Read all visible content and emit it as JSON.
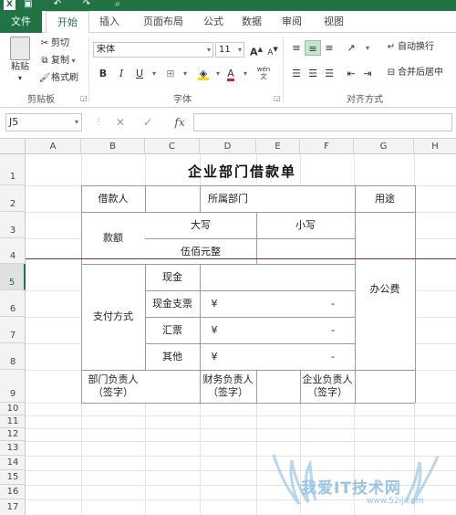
{
  "ribbon_tabs": [
    "文件",
    "开始",
    "插入",
    "页面布局",
    "公式",
    "数据",
    "审阅",
    "视图"
  ],
  "clipboard": {
    "paste": "粘贴",
    "cut": "剪切",
    "copy": "复制",
    "format_painter": "格式刷",
    "group_label": "剪贴板"
  },
  "font": {
    "name": "宋体",
    "size": "11",
    "grow": "A",
    "shrink": "A",
    "bold": "B",
    "italic": "I",
    "underline": "U",
    "wen": "wén",
    "group_label": "字体"
  },
  "alignment": {
    "wrap_text": "自动换行",
    "merge_center": "合并后居中",
    "group_label": "对齐方式"
  },
  "formula_bar": {
    "cell_ref": "J5",
    "fx": "fx",
    "value": ""
  },
  "columns": [
    "A",
    "B",
    "C",
    "D",
    "E",
    "F",
    "G",
    "H"
  ],
  "rows": [
    "1",
    "2",
    "3",
    "4",
    "5",
    "6",
    "7",
    "8",
    "9",
    "10",
    "11",
    "12",
    "13",
    "14",
    "15",
    "16",
    "17"
  ],
  "form": {
    "title": "企业部门借款单",
    "borrower": "借款人",
    "department": "所属部门",
    "purpose": "用途",
    "amount": "款额",
    "uppercase": "大写",
    "lowercase": "小写",
    "amount_upper": "伍佰元整",
    "purpose_value": "办公费",
    "payment_method": "支付方式",
    "cash": "现金",
    "cash_check": "现金支票",
    "draft": "汇票",
    "other": "其他",
    "yen": "¥",
    "dash": "-",
    "dept_head": "部门负责人",
    "finance_head": "财务负责人",
    "company_head": "企业负责人",
    "sign": "（签字）"
  },
  "watermark": {
    "text": "我爱IT技术网",
    "url": "www.52ij.com"
  },
  "colors": {
    "accent": "#217346",
    "page_break": "#8b2a2a",
    "watermark": "#9ac4e6"
  }
}
